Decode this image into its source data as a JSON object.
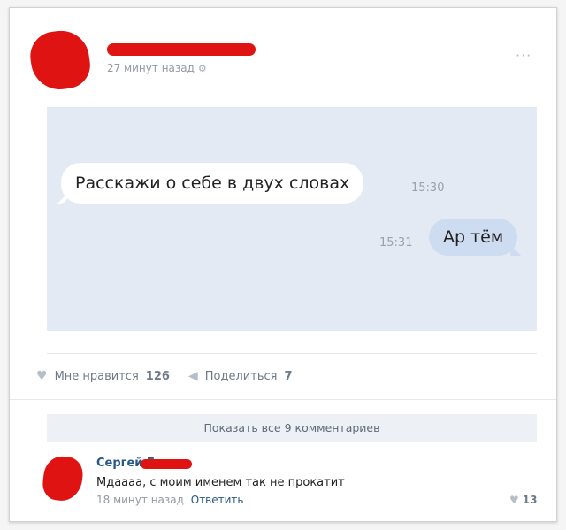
{
  "post": {
    "time": "27 минут назад",
    "more_icon": "ellipsis-icon"
  },
  "chat": {
    "incoming": {
      "text": "Расскажи о себе в двух словах",
      "time": "15:30"
    },
    "outgoing": {
      "text": "Ар тём",
      "time": "15:31"
    }
  },
  "actions": {
    "like_label": "Мне нравится",
    "like_count": "126",
    "share_label": "Поделиться",
    "share_count": "7"
  },
  "comments": {
    "show_all_label": "Показать все 9 комментариев",
    "items": [
      {
        "author": "Сергей Г",
        "text": "Мдаааа, с моим именем так не прокатит",
        "time": "18 минут назад",
        "reply_label": "Ответить",
        "likes": "13"
      }
    ]
  },
  "colors": {
    "redaction": "#e01313",
    "chat_background": "#e4eaf3",
    "outgoing_bubble": "#cddcf0",
    "link": "#2a5885"
  }
}
